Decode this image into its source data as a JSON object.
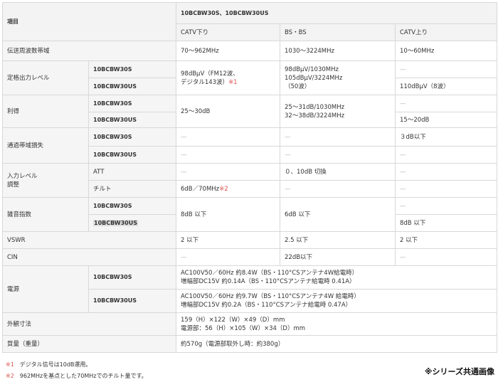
{
  "header": {
    "item_label": "項目",
    "models": "10BCBW30S、10BCBW30US",
    "catv_down": "CATV下り",
    "bs_cs": "BS・BS",
    "catv_up": "CATV上り"
  },
  "models": {
    "s": "10BCBW30S",
    "us": "10BCBW30US"
  },
  "dash": "—",
  "rows": {
    "band": {
      "label": "伝送周波数帯域",
      "catv_down": "70〜962MHz",
      "bs": "1030〜3224MHz",
      "catv_up": "10〜60MHz"
    },
    "output": {
      "label": "定格出力レベル",
      "catv_down_l1": "98dBμV（FM12波、",
      "catv_down_l2": "デジタル143波）",
      "catv_down_note": "※1",
      "bs_l1": "98dBμV/1030MHz",
      "bs_l2": "105dBμV/3224MHz",
      "bs_l3": "（50波）",
      "us_catv_up": "110dBμV（8波）"
    },
    "gain": {
      "label": "利得",
      "catv_down": "25〜30dB",
      "bs_l1": "25〜31dB/1030MHz",
      "bs_l2": "32〜38dB/3224MHz",
      "us_catv_up": "15〜20dB"
    },
    "loss": {
      "label": "通過帯域損失",
      "s_catv_up": "３dB以下"
    },
    "input": {
      "label_l1": "入力レベル",
      "label_l2": "調整",
      "att": "ATT",
      "tilt": "チルト",
      "att_bs": "０、10dB 切換",
      "tilt_catv_down": "6dB／70MHz",
      "tilt_note": "※2"
    },
    "noise": {
      "label": "雑音指数",
      "catv_down": "8dB 以下",
      "bs": "6dB 以下",
      "us_catv_up": "8dB 以下"
    },
    "vswr": {
      "label": "VSWR",
      "catv_down": "2 以下",
      "bs": "2.5 以下",
      "catv_up": "2 以下"
    },
    "cin": {
      "label": "CIN",
      "bs": "22dB以下"
    },
    "power": {
      "label": "電源",
      "s_l1": "AC100V50／60Hz 約8.4W（BS・110°CSアンテナ4W給電時）",
      "s_l2": "増幅部DC15V 約0.14A（BS・110°CSアンテナ給電時 0.41A）",
      "us_l1": "AC100V50／60Hz 約9.7W（BS・110°CSアンテナ4W 給電時）",
      "us_l2": "増幅部DC15V 約0.2A（BS・110°CSアンテナ給電時 0.47A）"
    },
    "size": {
      "label": "外観寸法",
      "l1": "159（H）×122（W）×49（D）mm",
      "l2": "電源部：56（H）×105（W）×34（D）mm"
    },
    "weight": {
      "label": "質量（重量）",
      "value": "約570g（電源部取外し時：約380g）"
    }
  },
  "notes": [
    {
      "mark": "※1",
      "text": "デジタル信号は10dB運用。"
    },
    {
      "mark": "※2",
      "text": "962MHzを基点とした70MHzでのチルト量です。"
    }
  ],
  "stamp": "※シリーズ共通画像"
}
